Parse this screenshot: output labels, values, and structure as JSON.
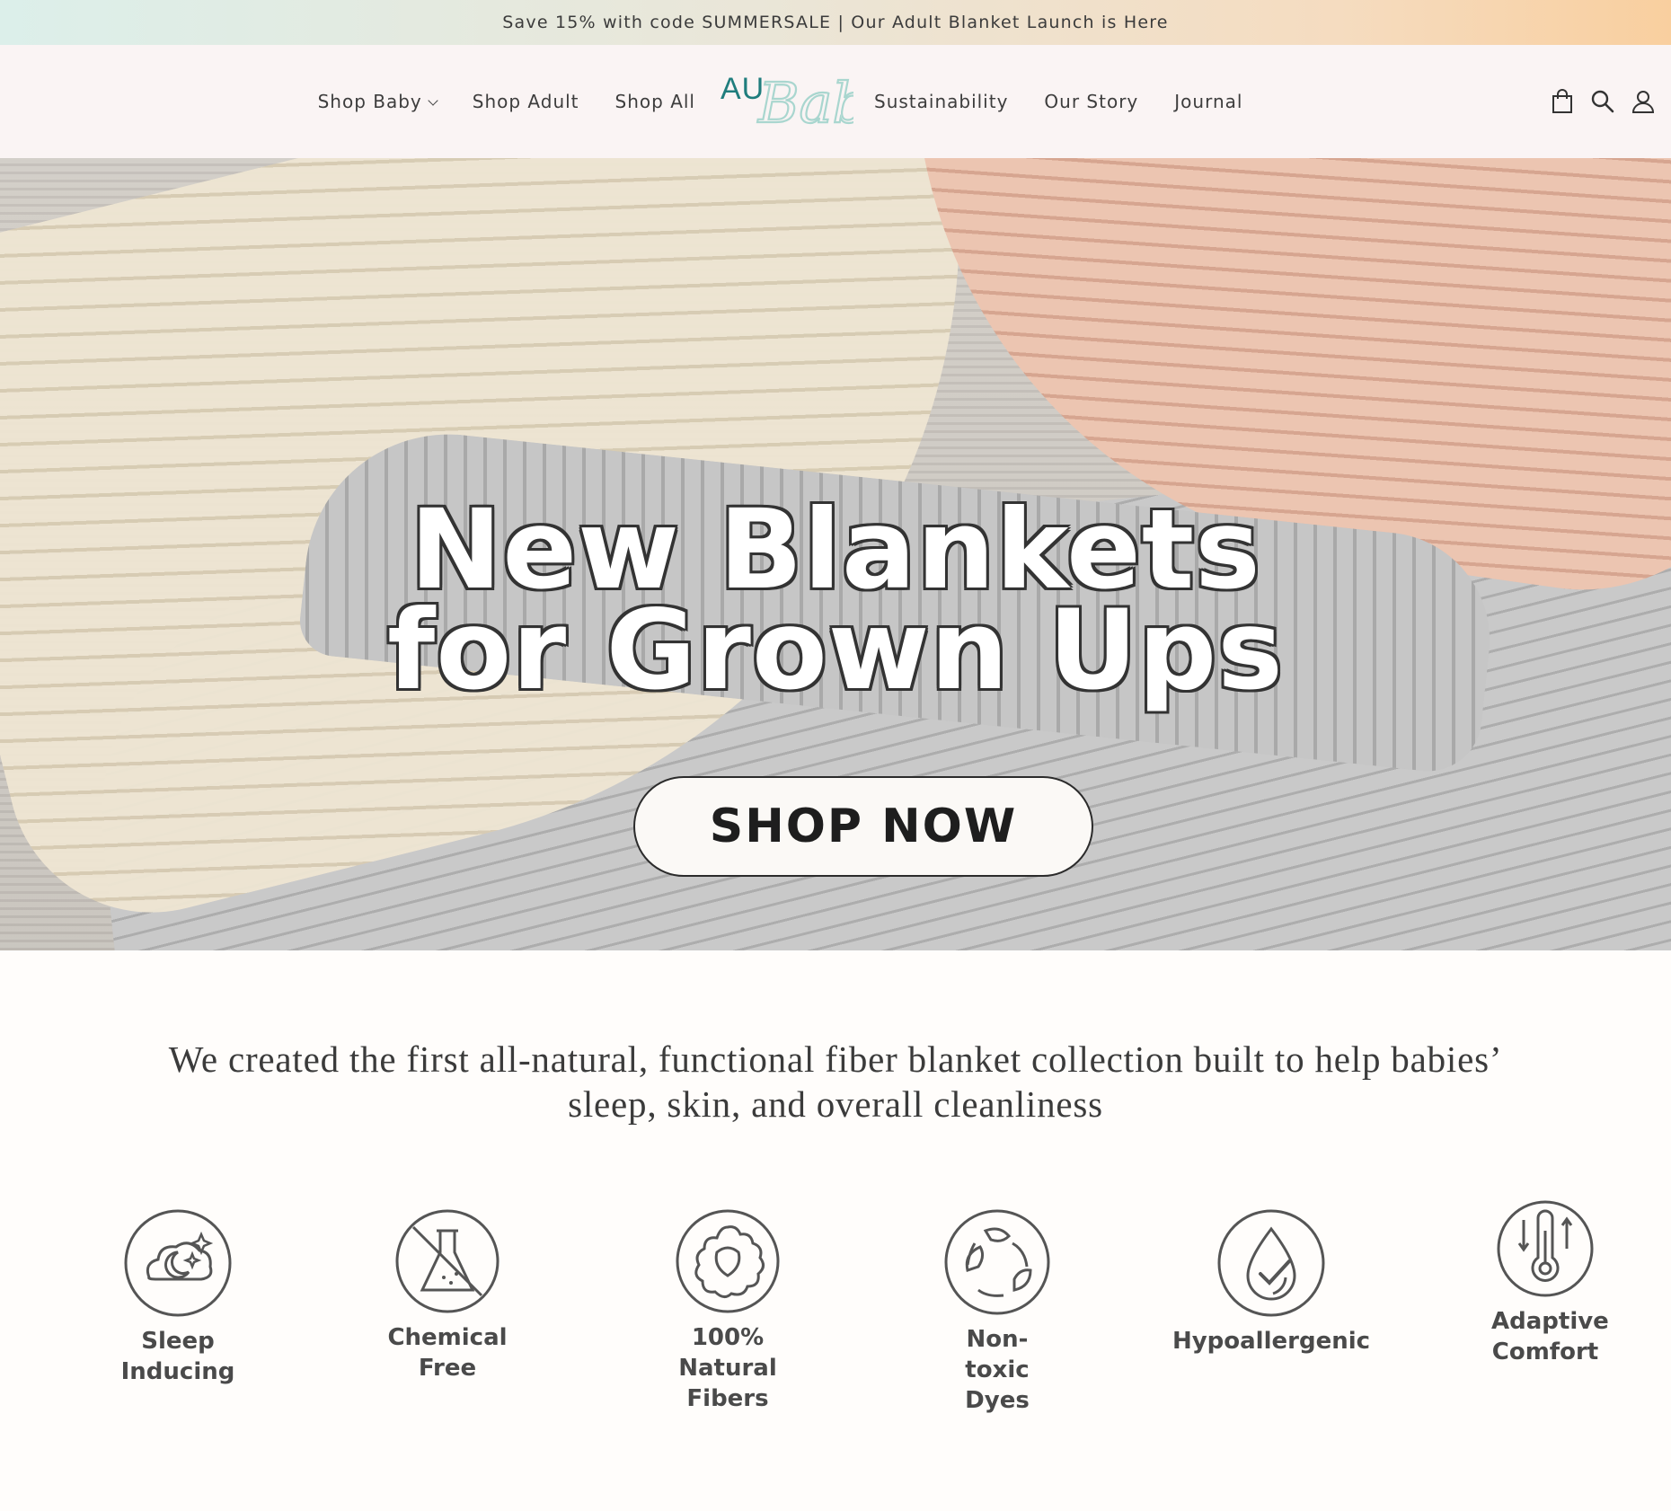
{
  "announcement": "Save 15% with code SUMMERSALE | Our Adult Blanket Launch is Here",
  "header": {
    "logo_prefix": "AU",
    "logo_script": "Baby",
    "nav_left": [
      "Shop Baby",
      "Shop Adult",
      "Shop All"
    ],
    "nav_right": [
      "Sustainability",
      "Our Story",
      "Journal"
    ],
    "icons": [
      "cart-icon",
      "search-icon",
      "account-icon"
    ]
  },
  "hero": {
    "line1": "New Blankets",
    "line2": "for Grown Ups",
    "cta": "SHOP NOW"
  },
  "mission": {
    "line1": "We created the first all-natural, functional fiber blanket collection built to help babies’",
    "line2": "sleep, skin, and overall cleanliness"
  },
  "features": [
    {
      "line1": "Sleep",
      "line2": "Inducing",
      "icon": "sleep-moon-cloud-icon"
    },
    {
      "line1": "Chemical",
      "line2": "Free",
      "icon": "no-chemical-flask-icon"
    },
    {
      "line1": "100% Natural",
      "line2": "Fibers",
      "icon": "sheep-wool-icon"
    },
    {
      "line1": "Non-toxic",
      "line2": "Dyes",
      "icon": "recycle-leaf-icon"
    },
    {
      "line1": "Hypoallergenic",
      "line2": "",
      "icon": "drop-check-icon"
    },
    {
      "line1": "Adaptive",
      "line2": "Comfort",
      "icon": "thermometer-icon"
    }
  ],
  "colors": {
    "header_bg": "#faf4f4",
    "logo_teal": "#1f7d7d",
    "logo_script": "#a9d6cf",
    "icon_stroke": "#555555"
  }
}
